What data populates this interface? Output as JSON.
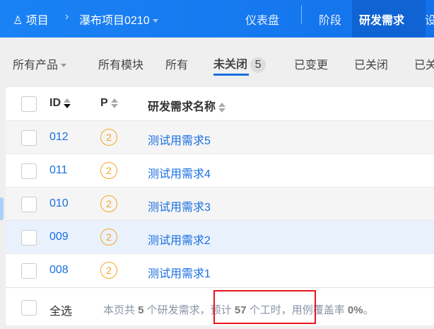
{
  "header": {
    "breadcrumb_root": "项目",
    "project": "瀑布项目0210",
    "nav": [
      "仪表盘",
      "阶段",
      "研发需求",
      "设"
    ],
    "active_nav": "研发需求"
  },
  "filters": {
    "product": "所有产品",
    "module": "所有模块",
    "tabs": [
      "所有",
      "未关闭",
      "已变更",
      "已关闭",
      "已关"
    ],
    "active_tab": "未关闭",
    "active_count": "5"
  },
  "table": {
    "columns": [
      "ID",
      "P",
      "研发需求名称"
    ],
    "rows": [
      {
        "id": "012",
        "p": "2",
        "name": "测试用需求5"
      },
      {
        "id": "011",
        "p": "2",
        "name": "测试用需求4"
      },
      {
        "id": "010",
        "p": "2",
        "name": "测试用需求3"
      },
      {
        "id": "009",
        "p": "2",
        "name": "测试用需求2"
      },
      {
        "id": "008",
        "p": "2",
        "name": "测试用需求1"
      }
    ]
  },
  "footer": {
    "select_all": "全选",
    "s1": "本页共 ",
    "count": "5",
    "s2": " 个研发需求，预计 ",
    "hours": "57",
    "s3": " 个工时，用例覆盖率 ",
    "coverage": "0%",
    "s4": "。"
  },
  "colors": {
    "primary": "#1a6fe0",
    "highlight": "#e8141e"
  }
}
